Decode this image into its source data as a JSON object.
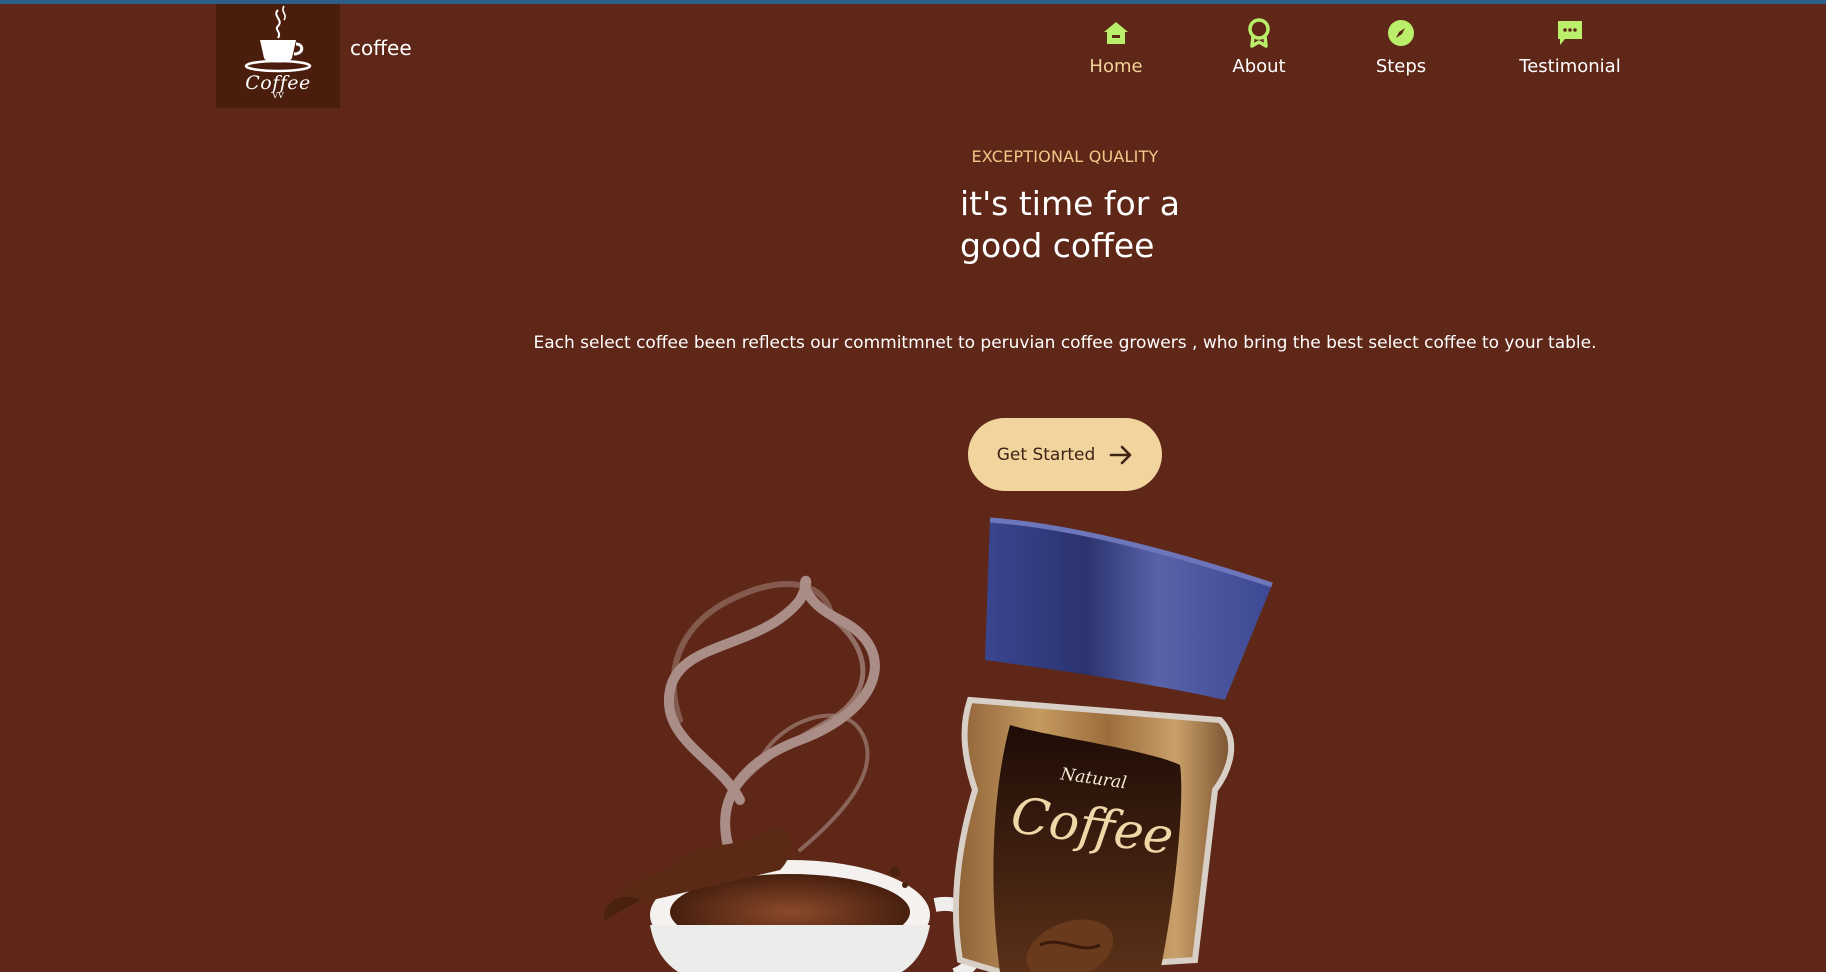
{
  "header": {
    "logo": {
      "name": "Coffee",
      "sub": "VV"
    },
    "brand": "coffee"
  },
  "nav": {
    "items": [
      {
        "label": "Home",
        "icon": "home-icon",
        "active": true
      },
      {
        "label": "About",
        "icon": "award-icon",
        "active": false
      },
      {
        "label": "Steps",
        "icon": "compass-icon",
        "active": false
      },
      {
        "label": "Testimonial",
        "icon": "chat-icon",
        "active": false
      }
    ]
  },
  "hero": {
    "eyebrow": "EXCEPTIONAL QUALITY",
    "headline_line1": "it's time for a",
    "headline_line2": "good coffee",
    "description": "Each select coffee been reflects our commitmnet to peruvian coffee growers , who bring the best select coffee to your table.",
    "cta_label": "Get Started",
    "cta_icon": "arrow-right-icon",
    "jar_label_top": "Natural",
    "jar_label_main": "Coffee"
  },
  "colors": {
    "background": "#5e2718",
    "accent": "#f1d49e",
    "icon_green": "#b9ef6b",
    "jar_lid": "#3d4894"
  }
}
